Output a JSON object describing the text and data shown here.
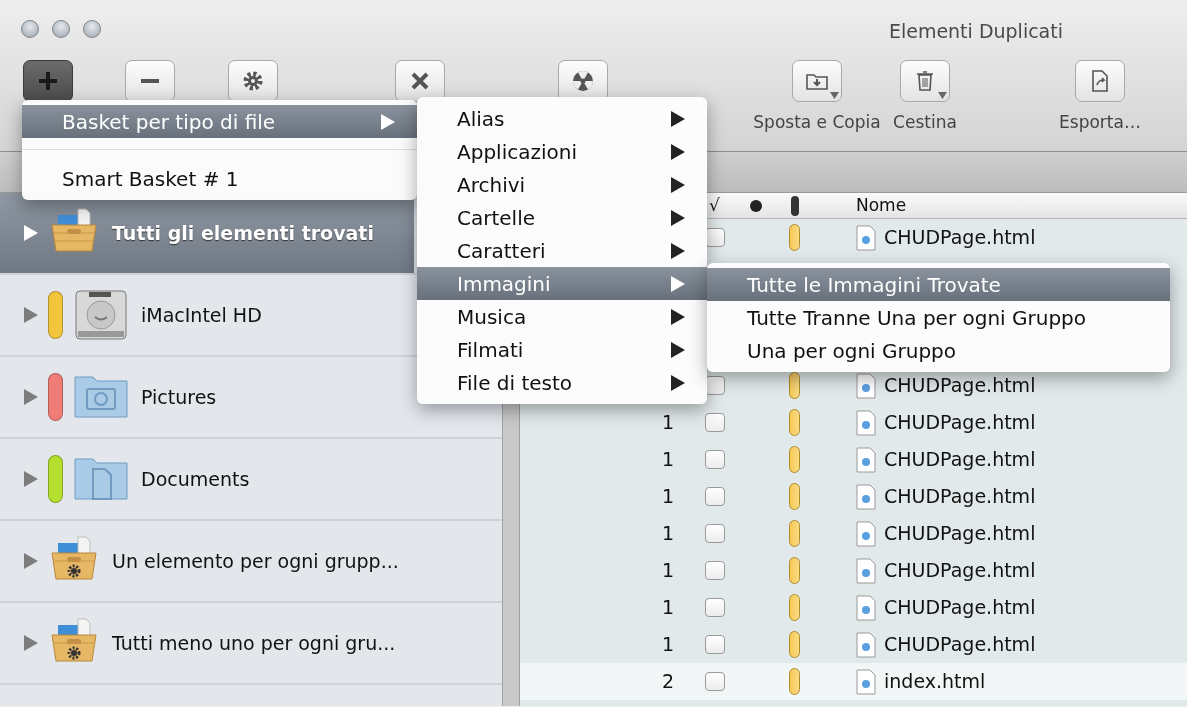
{
  "window": {
    "title": "Elementi Duplicati"
  },
  "toolbar": [
    {
      "kind": "add",
      "pressed": true
    },
    {
      "kind": "remove",
      "pressed": false
    },
    {
      "kind": "gear",
      "pressed": false
    },
    {
      "kind": "cross",
      "pressed": false
    },
    {
      "kind": "radiation",
      "pressed": false
    },
    {
      "kind": "move",
      "label": "Sposta e Copia",
      "has_menu": true,
      "pressed": false
    },
    {
      "kind": "trash",
      "label": "Cestina",
      "has_menu": true,
      "pressed": false
    },
    {
      "kind": "export",
      "label": "Esporta…",
      "has_menu": false,
      "pressed": false
    }
  ],
  "sidebar": {
    "items": [
      {
        "kind": "basket",
        "label": "Tutti gli elementi trovati",
        "selected": true
      },
      {
        "kind": "drive",
        "label": "iMacIntel HD",
        "color": "#f2c53d",
        "selected": false
      },
      {
        "kind": "photo-folder",
        "label": "Pictures",
        "color": "#f07c78",
        "selected": false
      },
      {
        "kind": "doc-folder",
        "label": "Documents",
        "color": "#b5df2f",
        "selected": false
      },
      {
        "kind": "smart-basket",
        "label": "Un elemento per ogni grupp...",
        "selected": false
      },
      {
        "kind": "smart-basket",
        "label": "Tutti meno uno per ogni gru...",
        "selected": false
      }
    ]
  },
  "table": {
    "columns": [
      {
        "kind": "count"
      },
      {
        "kind": "check",
        "label": "√"
      },
      {
        "kind": "dot"
      },
      {
        "kind": "pill"
      },
      {
        "kind": "name",
        "label": "Nome"
      }
    ],
    "rows": [
      {
        "checked": false,
        "name": "CHUDPage.html"
      },
      {},
      {},
      {},
      {
        "checked": false,
        "name": "CHUDPage.html"
      },
      {
        "count": "1",
        "checked": false,
        "name": "CHUDPage.html",
        "shaded": true
      },
      {
        "count": "1",
        "checked": false,
        "name": "CHUDPage.html",
        "shaded": true
      },
      {
        "count": "1",
        "checked": false,
        "name": "CHUDPage.html",
        "shaded": true
      },
      {
        "count": "1",
        "checked": false,
        "name": "CHUDPage.html",
        "shaded": true
      },
      {
        "count": "1",
        "checked": false,
        "name": "CHUDPage.html",
        "shaded": true
      },
      {
        "count": "1",
        "checked": false,
        "name": "CHUDPage.html",
        "shaded": true
      },
      {
        "count": "1",
        "checked": false,
        "name": "CHUDPage.html",
        "shaded": true
      },
      {
        "count": "2",
        "checked": false,
        "name": "index.html",
        "shaded": false
      }
    ]
  },
  "menus": [
    {
      "items": [
        {
          "label": "Basket per tipo di file",
          "submenu": true,
          "selected": true
        },
        {
          "kind": "separator"
        },
        {
          "label": "Smart Basket # 1",
          "submenu": false,
          "selected": false
        }
      ]
    },
    {
      "items": [
        {
          "label": "Alias",
          "submenu": true,
          "selected": false
        },
        {
          "label": "Applicazioni",
          "submenu": true,
          "selected": false
        },
        {
          "label": "Archivi",
          "submenu": true,
          "selected": false
        },
        {
          "label": "Cartelle",
          "submenu": true,
          "selected": false
        },
        {
          "label": "Caratteri",
          "submenu": true,
          "selected": false
        },
        {
          "label": "Immagini",
          "submenu": true,
          "selected": true
        },
        {
          "label": "Musica",
          "submenu": true,
          "selected": false
        },
        {
          "label": "Filmati",
          "submenu": true,
          "selected": false
        },
        {
          "label": "File di testo",
          "submenu": true,
          "selected": false
        }
      ]
    },
    {
      "items": [
        {
          "label": "Tutte le Immagini Trovate",
          "submenu": false,
          "selected": true
        },
        {
          "label": "Tutte Tranne Una per ogni Gruppo",
          "submenu": false,
          "selected": false
        },
        {
          "label": "Una per ogni Gruppo",
          "submenu": false,
          "selected": false
        }
      ]
    }
  ]
}
